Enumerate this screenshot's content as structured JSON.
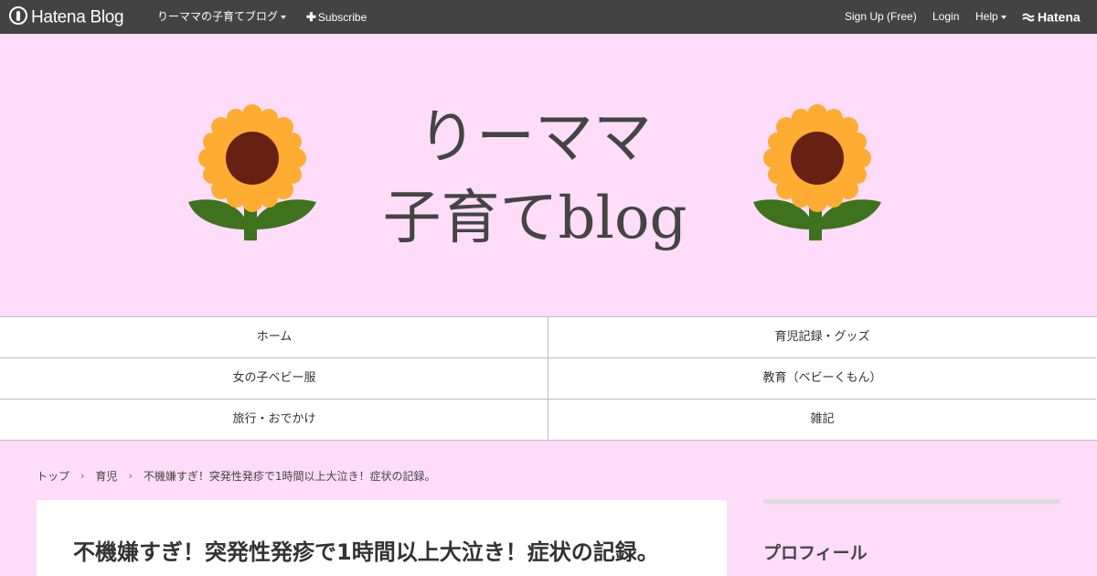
{
  "topbar": {
    "logo_text": "Hatena Blog",
    "blog_menu": "りーママの子育てブログ",
    "subscribe": "Subscribe",
    "signup": "Sign Up (Free)",
    "login": "Login",
    "help": "Help",
    "hatena": "Hatena"
  },
  "banner": {
    "title_line1": "りーママ",
    "title_line2": "子育てblog",
    "icon_left": "sunflower-icon",
    "icon_right": "sunflower-icon"
  },
  "nav": {
    "items": [
      {
        "label": "ホーム"
      },
      {
        "label": "育児記録・グッズ"
      },
      {
        "label": "女の子ベビー服"
      },
      {
        "label": "教育（ベビーくもん）"
      },
      {
        "label": "旅行・おでかけ"
      },
      {
        "label": "雑記"
      }
    ]
  },
  "breadcrumb": {
    "items": [
      {
        "label": "トップ"
      },
      {
        "label": "育児"
      },
      {
        "label": "不機嫌すぎ！突発性発疹で1時間以上大泣き！症状の記録。"
      }
    ],
    "separator": "›"
  },
  "article": {
    "title": "不機嫌すぎ！突発性発疹で1時間以上大泣き！症状の記録。"
  },
  "sidebar": {
    "profile_heading": "プロフィール"
  },
  "colors": {
    "page_bg": "#ffdcf9",
    "topbar_bg": "#434343",
    "petal": "#ffac33",
    "center": "#662113",
    "leaf": "#3e721d"
  }
}
